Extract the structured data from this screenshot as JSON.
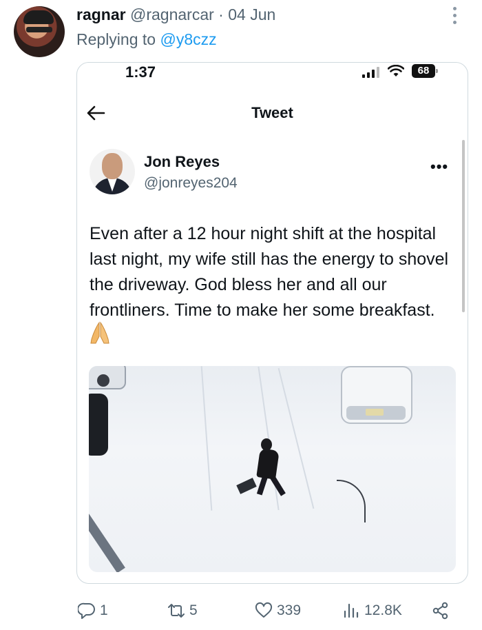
{
  "post": {
    "display_name": "ragnar",
    "handle": "@ragnarcar",
    "separator": "·",
    "date": "04 Jun",
    "replying_prefix": "Replying to",
    "replying_to": "@y8czz"
  },
  "screenshot": {
    "status_time": "1:37",
    "battery": "68",
    "header_title": "Tweet",
    "author_name": "Jon Reyes",
    "author_handle": "@jonreyes204",
    "tweet_text": "Even after a 12 hour night shift at the hospital last night, my wife still has the energy to shovel the driveway. God bless her and all our frontliners. Time to make her some breakfast.",
    "emoji": "folded-hands-emoji"
  },
  "actions": {
    "replies": "1",
    "retweets": "5",
    "likes": "339",
    "views": "12.8K"
  },
  "colors": {
    "link": "#1d9bf0",
    "muted": "#536471",
    "border": "#cfd9de"
  }
}
